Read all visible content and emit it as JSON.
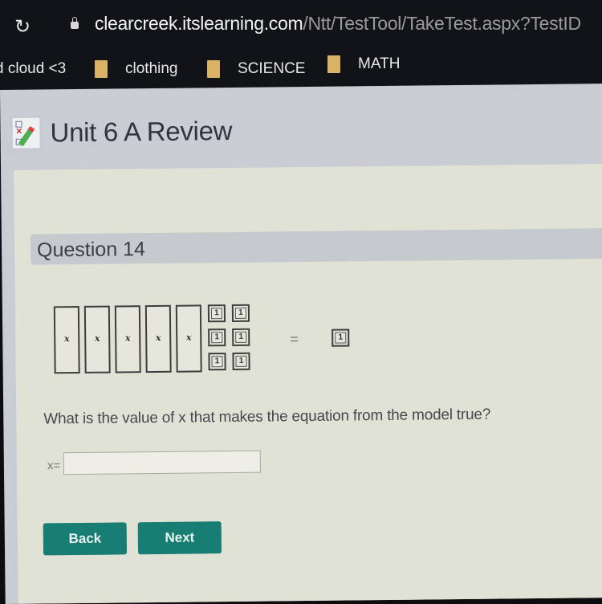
{
  "browser": {
    "reload_icon": "↻",
    "url_host": "clearcreek.itslearning.com",
    "url_path": "/Ntt/TestTool/TakeTest.aspx?TestID",
    "bookmarks": [
      {
        "label": "d cloud <3",
        "has_folder": false
      },
      {
        "label": "clothing",
        "has_folder": true
      },
      {
        "label": "SCIENCE",
        "has_folder": true
      },
      {
        "label": "MATH",
        "has_folder": true
      }
    ]
  },
  "page": {
    "title": "Unit 6 A Review",
    "title_icon": "test-checklist-icon"
  },
  "question": {
    "header": "Question 14",
    "model": {
      "x_tiles": [
        "x",
        "x",
        "x",
        "x",
        "x"
      ],
      "unit_tiles_left": [
        "1",
        "1",
        "1",
        "1",
        "1",
        "1"
      ],
      "equals": "=",
      "unit_tiles_right": [
        "1"
      ]
    },
    "prompt": "What is the value of x that makes the equation from the model true?",
    "answer_label": "x=",
    "answer_value": ""
  },
  "buttons": {
    "back": "Back",
    "next": "Next"
  },
  "colors": {
    "button": "#187d73",
    "content_bg": "#e1e2d6",
    "header_bg": "#c6c9cd"
  }
}
